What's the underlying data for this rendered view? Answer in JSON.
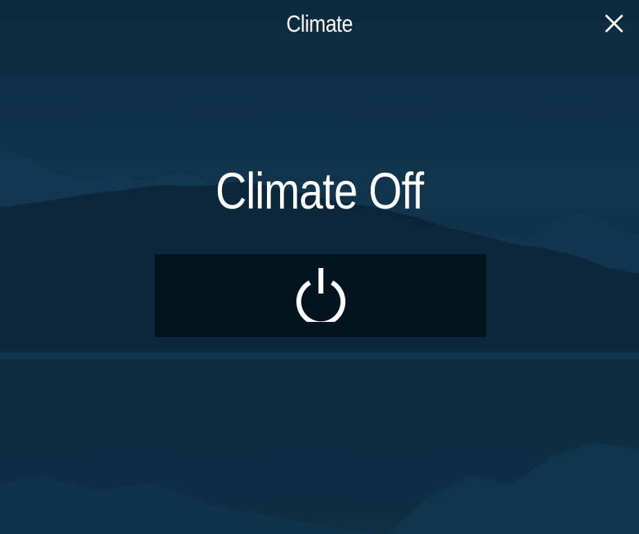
{
  "header": {
    "title": "Climate",
    "close_icon": "close-icon"
  },
  "main": {
    "status_text": "Climate Off",
    "power_icon": "power-icon"
  },
  "colors": {
    "background": "#0e2e44",
    "button": "#03141f",
    "text": "#ffffff"
  }
}
